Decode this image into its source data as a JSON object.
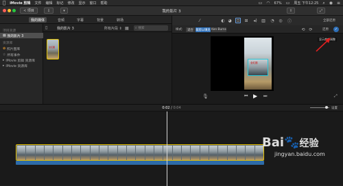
{
  "menubar": {
    "apple": "",
    "app_name": "iMovie 剪辑",
    "items": [
      "文件",
      "编辑",
      "标记",
      "修改",
      "显示",
      "窗口",
      "帮助"
    ],
    "battery": "67%",
    "clock": "周五 下午12:25"
  },
  "toolbar": {
    "back_label": "< 项目",
    "title": "我的影片 3"
  },
  "library_tabs": [
    "我的媒体",
    "音频",
    "字幕",
    "背景",
    "转场"
  ],
  "sidebar": {
    "section_projects": "项目资源",
    "project_item": "我的影片 3",
    "section_libraries": "资源库",
    "photo_library": "照片图库",
    "all_events": "所有事件",
    "library1": "iMovie 剪辑 资源库",
    "library2": "iMovie 资源库"
  },
  "browser": {
    "title": "我的影片 3",
    "filter": "所有片段",
    "search_placeholder": "搜索",
    "thumb_caption": "全红图"
  },
  "viewer": {
    "reset_label": "全部还原",
    "style_label": "样式:",
    "style_options": [
      "适合",
      "裁剪以填充",
      "Ken Burns"
    ],
    "reset_short": "还原",
    "tooltip": "显示裁剪调整",
    "clip_caption": "全红图"
  },
  "timeline": {
    "timecode_current": "0:02",
    "timecode_sep": "/",
    "timecode_total": "0:04",
    "settings_label": "设置",
    "frame_count": 27
  },
  "watermark": {
    "brand": "Bai",
    "brand_cn": "经验",
    "url": "jingyan.baidu.com"
  },
  "colors": {
    "accent": "#2e6fb8",
    "clip_border": "#e6c100",
    "annotation": "#e02020"
  }
}
